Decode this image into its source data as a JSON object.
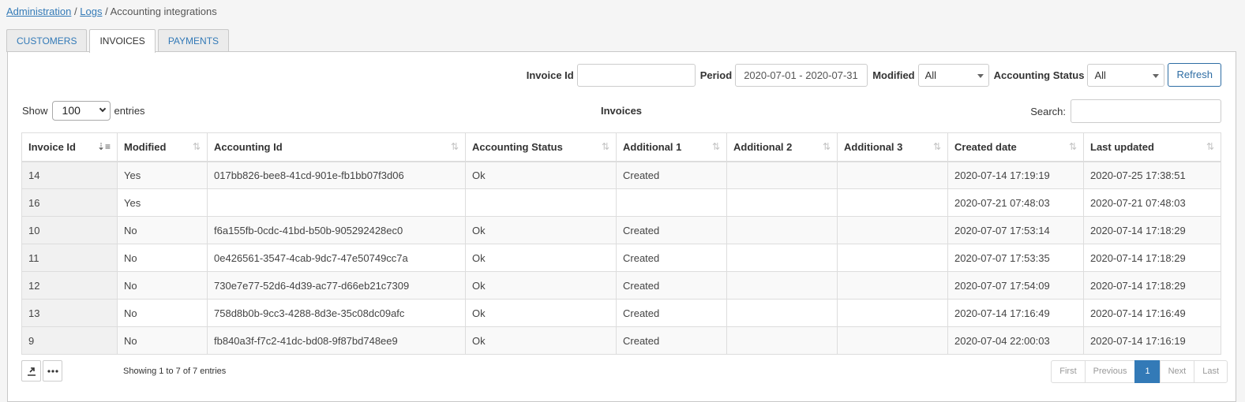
{
  "breadcrumb": {
    "administration": "Administration",
    "logs": "Logs",
    "current": "Accounting integrations",
    "sep": "/"
  },
  "tabs": [
    "CUSTOMERS",
    "INVOICES",
    "PAYMENTS"
  ],
  "filters": {
    "invoice_id_label": "Invoice Id",
    "invoice_id_value": "",
    "period_label": "Period",
    "period_value": "2020-07-01 - 2020-07-31",
    "modified_label": "Modified",
    "modified_value": "All",
    "status_label": "Accounting Status",
    "status_value": "All",
    "refresh_label": "Refresh"
  },
  "length": {
    "show_label": "Show",
    "value": "100",
    "entries_label": "entries"
  },
  "table_caption": "Invoices",
  "search": {
    "label": "Search:",
    "value": ""
  },
  "columns": [
    "Invoice Id",
    "Modified",
    "Accounting Id",
    "Accounting Status",
    "Additional 1",
    "Additional 2",
    "Additional 3",
    "Created date",
    "Last updated"
  ],
  "rows": [
    [
      "14",
      "Yes",
      "017bb826-bee8-41cd-901e-fb1bb07f3d06",
      "Ok",
      "Created",
      "",
      "",
      "2020-07-14 17:19:19",
      "2020-07-25 17:38:51"
    ],
    [
      "16",
      "Yes",
      "",
      "",
      "",
      "",
      "",
      "2020-07-21 07:48:03",
      "2020-07-21 07:48:03"
    ],
    [
      "10",
      "No",
      "f6a155fb-0cdc-41bd-b50b-905292428ec0",
      "Ok",
      "Created",
      "",
      "",
      "2020-07-07 17:53:14",
      "2020-07-14 17:18:29"
    ],
    [
      "11",
      "No",
      "0e426561-3547-4cab-9dc7-47e50749cc7a",
      "Ok",
      "Created",
      "",
      "",
      "2020-07-07 17:53:35",
      "2020-07-14 17:18:29"
    ],
    [
      "12",
      "No",
      "730e7e77-52d6-4d39-ac77-d66eb21c7309",
      "Ok",
      "Created",
      "",
      "",
      "2020-07-07 17:54:09",
      "2020-07-14 17:18:29"
    ],
    [
      "13",
      "No",
      "758d8b0b-9cc3-4288-8d3e-35c08dc09afc",
      "Ok",
      "Created",
      "",
      "",
      "2020-07-14 17:16:49",
      "2020-07-14 17:16:49"
    ],
    [
      "9",
      "No",
      "fb840a3f-f7c2-41dc-bd08-9f87bd748ee9",
      "Ok",
      "Created",
      "",
      "",
      "2020-07-04 22:00:03",
      "2020-07-14 17:16:19"
    ]
  ],
  "info": "Showing 1 to 7 of 7 entries",
  "pager": {
    "first": "First",
    "previous": "Previous",
    "current": "1",
    "next": "Next",
    "last": "Last"
  },
  "icons": {
    "export": "export-icon",
    "more": "more-icon",
    "sort": "sort-icon"
  },
  "colors": {
    "link": "#337ab7",
    "primary": "#2e6da4"
  }
}
